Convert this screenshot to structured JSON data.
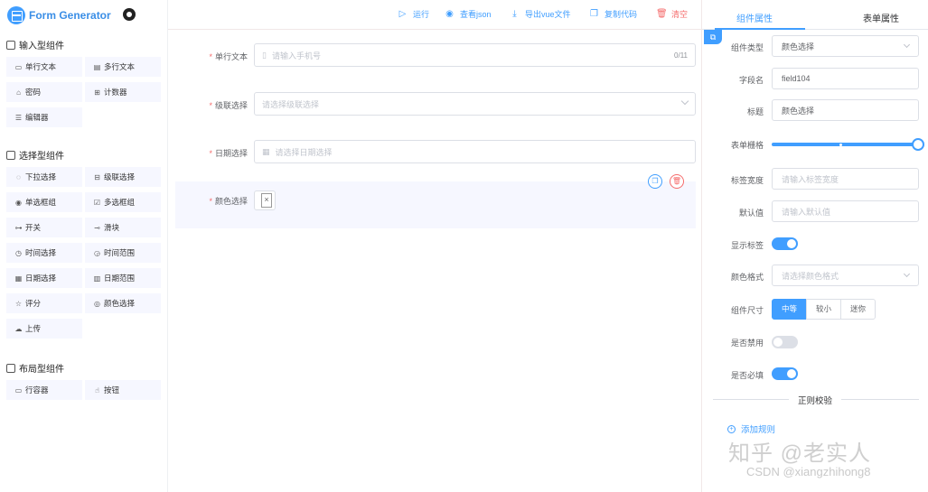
{
  "app": {
    "title": "Form Generator"
  },
  "toolbar": {
    "run": "运行",
    "view_json": "查看json",
    "export_vue": "导出vue文件",
    "copy_code": "复制代码",
    "clear": "清空"
  },
  "left": {
    "input_group_title": "输入型组件",
    "input_items": [
      "单行文本",
      "多行文本",
      "密码",
      "计数器",
      "编辑器"
    ],
    "select_group_title": "选择型组件",
    "select_items": [
      "下拉选择",
      "级联选择",
      "单选框组",
      "多选框组",
      "开关",
      "滑块",
      "时间选择",
      "时间范围",
      "日期选择",
      "日期范围",
      "评分",
      "颜色选择",
      "上传"
    ],
    "layout_group_title": "布局型组件",
    "layout_items": [
      "行容器",
      "按钮"
    ]
  },
  "canvas": {
    "fields": [
      {
        "label": "单行文本",
        "placeholder": "请输入手机号",
        "counter": "0/11"
      },
      {
        "label": "级联选择",
        "placeholder": "请选择级联选择"
      },
      {
        "label": "日期选择",
        "placeholder": "请选择日期选择"
      },
      {
        "label": "颜色选择"
      }
    ]
  },
  "panel": {
    "tab_component": "组件属性",
    "tab_form": "表单属性",
    "component_type_label": "组件类型",
    "component_type_value": "颜色选择",
    "field_name_label": "字段名",
    "field_name_value": "field104",
    "title_label": "标题",
    "title_value": "颜色选择",
    "grid_label": "表单栅格",
    "grid_span": 24,
    "label_width_label": "标签宽度",
    "label_width_placeholder": "请输入标签宽度",
    "default_label": "默认值",
    "default_placeholder": "请输入默认值",
    "show_label_label": "显示标签",
    "show_label_on": true,
    "color_format_label": "颜色格式",
    "color_format_placeholder": "请选择颜色格式",
    "size_label": "组件尺寸",
    "size_options": [
      "中等",
      "较小",
      "迷你"
    ],
    "size_selected": "中等",
    "disabled_label": "是否禁用",
    "disabled_on": false,
    "required_label": "是否必填",
    "required_on": true,
    "regex_title": "正则校验",
    "add_rule": "添加规则"
  },
  "watermark": {
    "line1": "知乎 @老实人",
    "line2": "CSDN @xiangzhihong8"
  },
  "colors": {
    "accent": "#409eff",
    "danger": "#f56c6c",
    "active_bg": "#f6f7ff"
  }
}
